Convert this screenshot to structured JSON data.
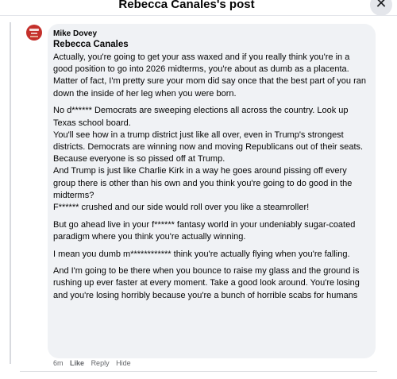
{
  "header": {
    "title": "Rebecca Canales's post",
    "close_glyph": "✕"
  },
  "comment": {
    "author": "Mike Dovey",
    "tagged_name": "Rebecca Canales",
    "paragraphs": [
      "Actually, you're going to get your ass waxed and if you really think you're in a good position to go into 2026 midterms, you're about as dumb as a placenta.\nMatter of fact, I'm pretty sure your mom did say once that the best part of you ran down the inside of her leg when you were born.",
      "No d****** Democrats are sweeping elections all across the country. Look up Texas school board.\nYou'll see how in a trump district just like all over, even in Trump's strongest districts. Democrats are winning now and moving Republicans out of their seats.\nBecause everyone is so pissed off at Trump.\nAnd Trump is just like Charlie Kirk in a way he goes around pissing off every group there is other than his own and you think you're going to do good in the midterms?\nF****** crushed and our side would roll over you like a steamroller!",
      "But go ahead live in your f****** fantasy world in your undeniably sugar-coated paradigm where you think you're actually winning.",
      "I mean you dumb m************ think you're actually flying when you're falling.",
      "And I'm going to be there when you bounce to raise my glass and the ground is rushing up ever faster at every moment. Take a good look around. You're losing and you're losing horribly because you're a bunch of horrible scabs for humans"
    ],
    "time": "6m",
    "actions": {
      "like": "Like",
      "reply": "Reply",
      "hide": "Hide"
    }
  },
  "colors": {
    "bubble": "#f0f2f5",
    "text": "#050505",
    "meta": "#65676b"
  },
  "icons": [
    "close-icon",
    "avatar"
  ]
}
